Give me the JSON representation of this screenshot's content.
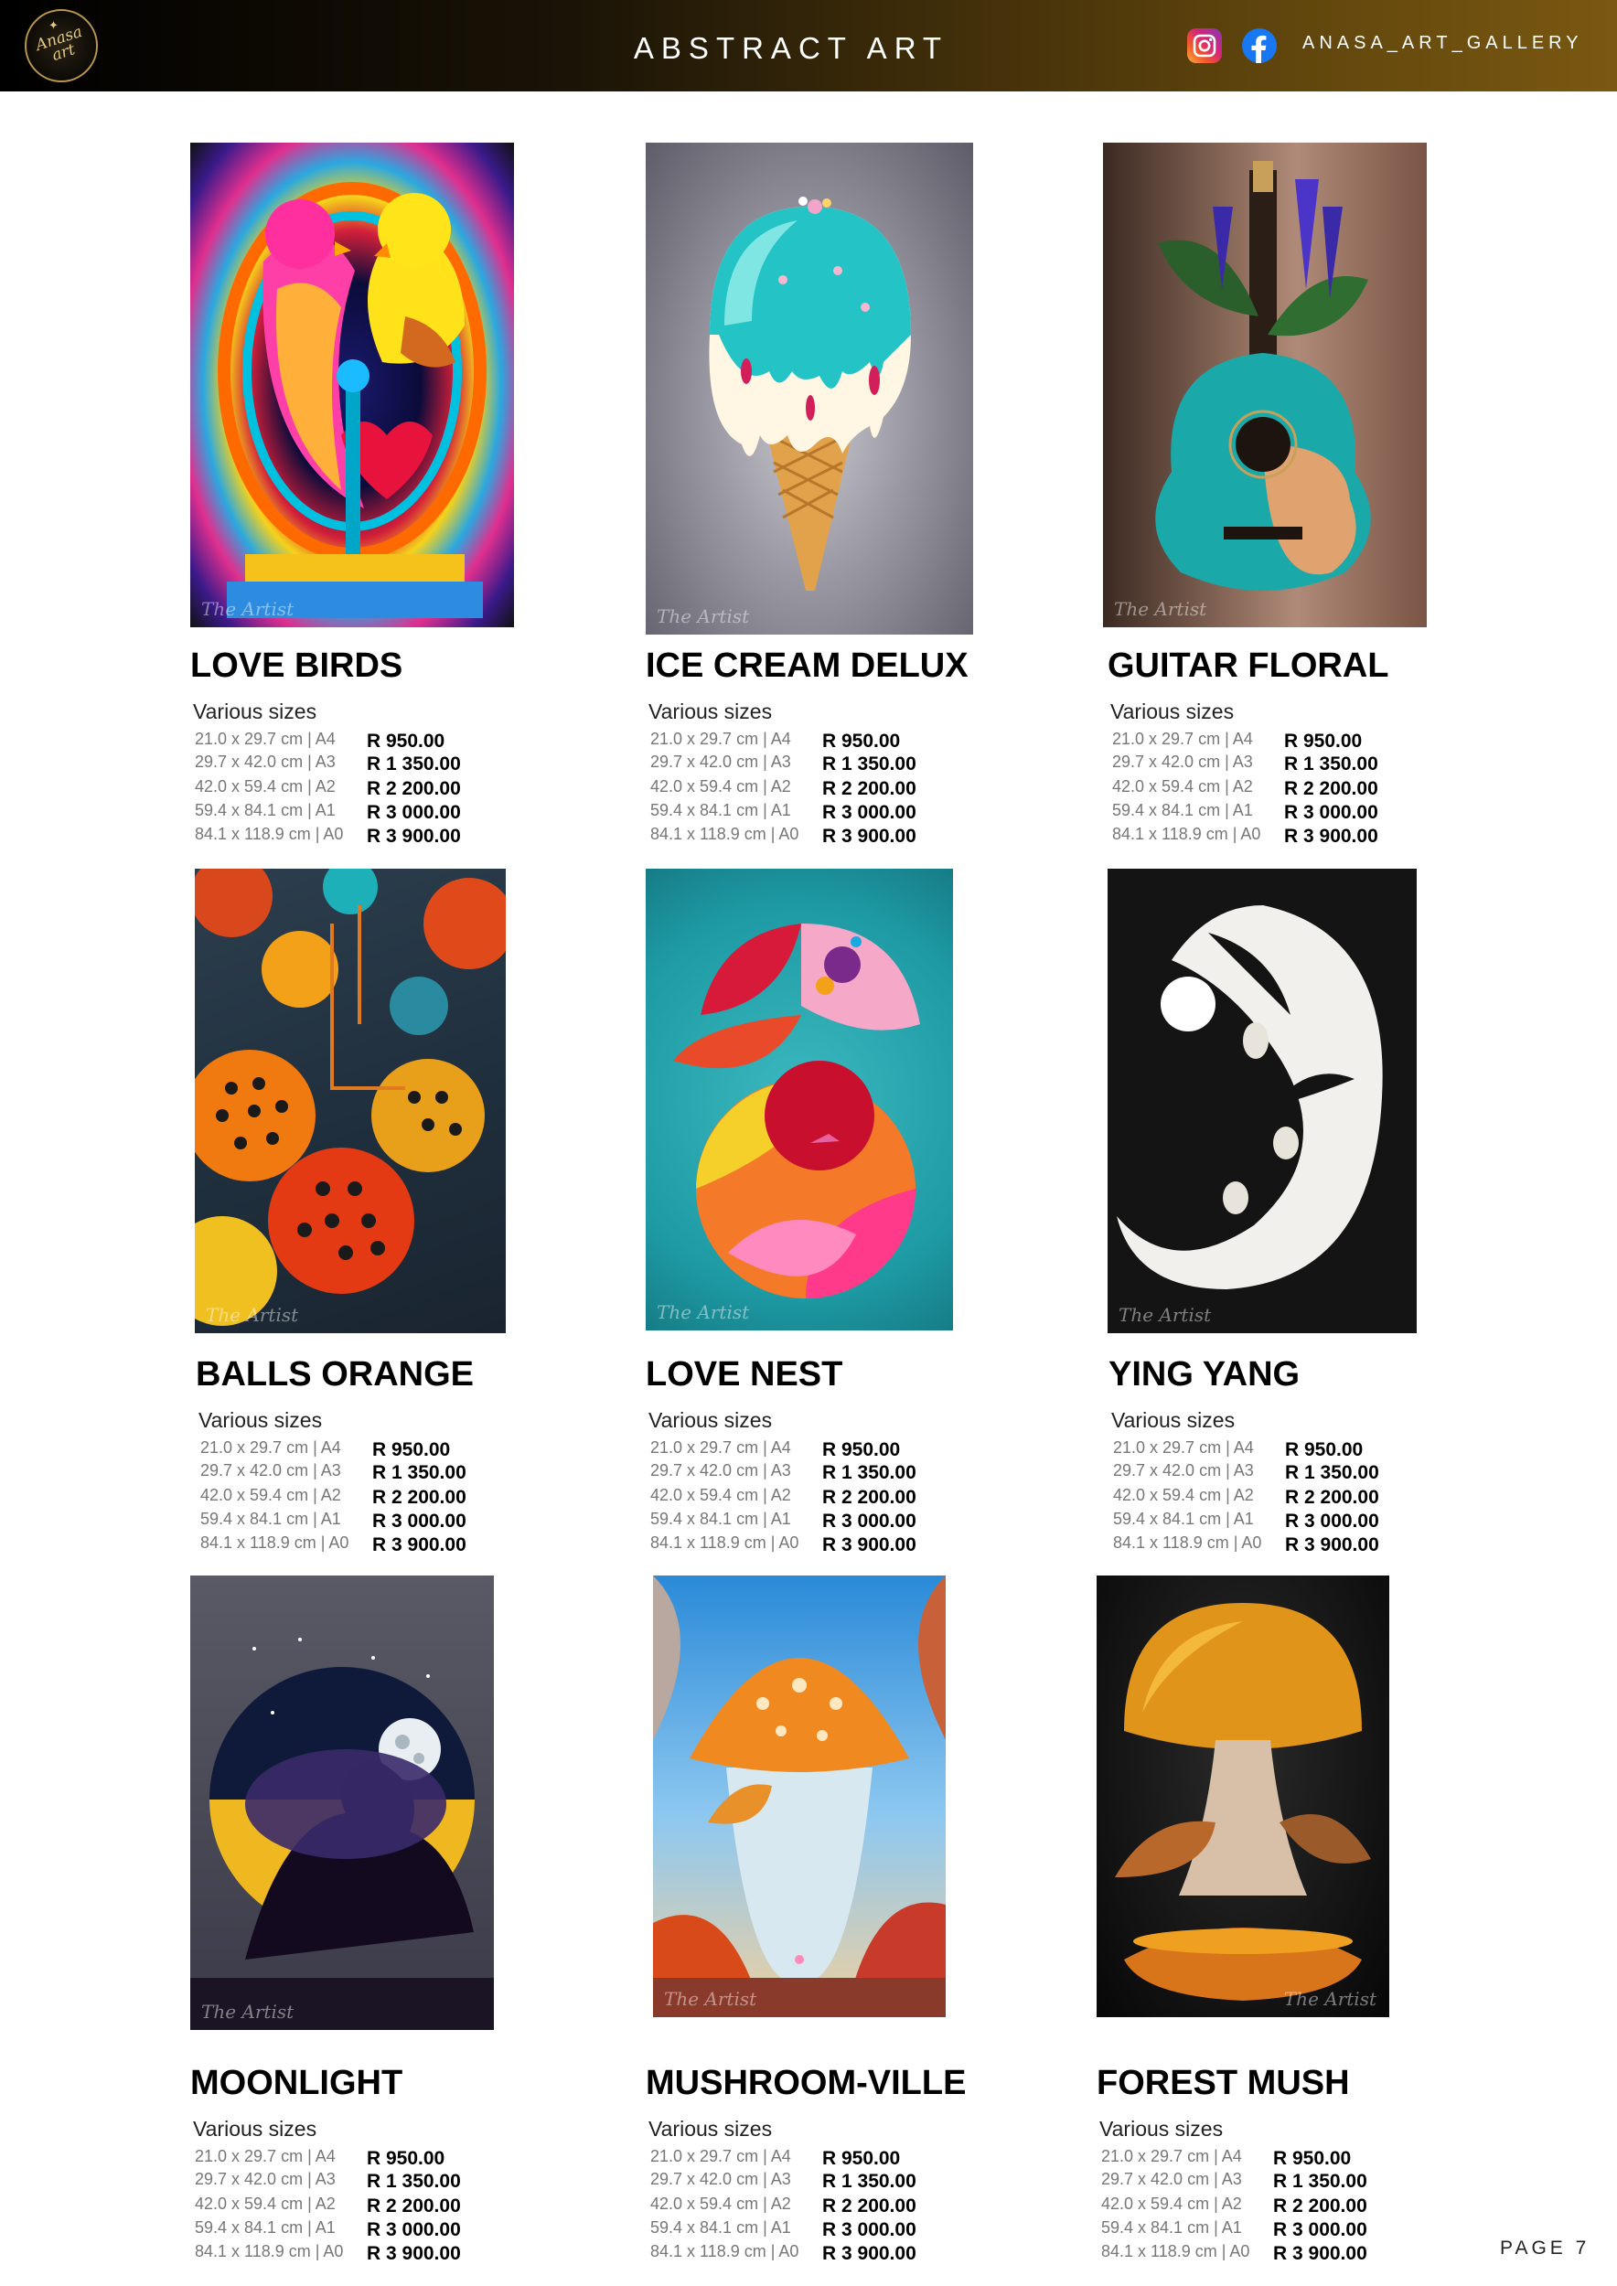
{
  "header": {
    "title": "ABSTRACT ART",
    "handle": "ANASA_ART_GALLERY",
    "logo_text": "Anasa art"
  },
  "artwork_signature": "The Artist",
  "size_label": "Various sizes",
  "sizes": [
    "21.0 x 29.7 cm | A4",
    "29.7 x 42.0 cm | A3",
    "42.0 x 59.4 cm | A2",
    "59.4 x 84.1 cm | A1",
    "84.1 x 118.9 cm | A0"
  ],
  "prices": [
    "R 950.00",
    "R 1 350.00",
    "R 2 200.00",
    "R 3 000.00",
    "R 3 900.00"
  ],
  "products": [
    {
      "name": "LOVE BIRDS"
    },
    {
      "name": "ICE CREAM DELUX"
    },
    {
      "name": "GUITAR FLORAL"
    },
    {
      "name": "BALLS ORANGE"
    },
    {
      "name": "LOVE NEST"
    },
    {
      "name": "YING YANG"
    },
    {
      "name": "MOONLIGHT"
    },
    {
      "name": "MUSHROOM-VILLE"
    },
    {
      "name": "FOREST MUSH"
    }
  ],
  "page": "PAGE 7"
}
